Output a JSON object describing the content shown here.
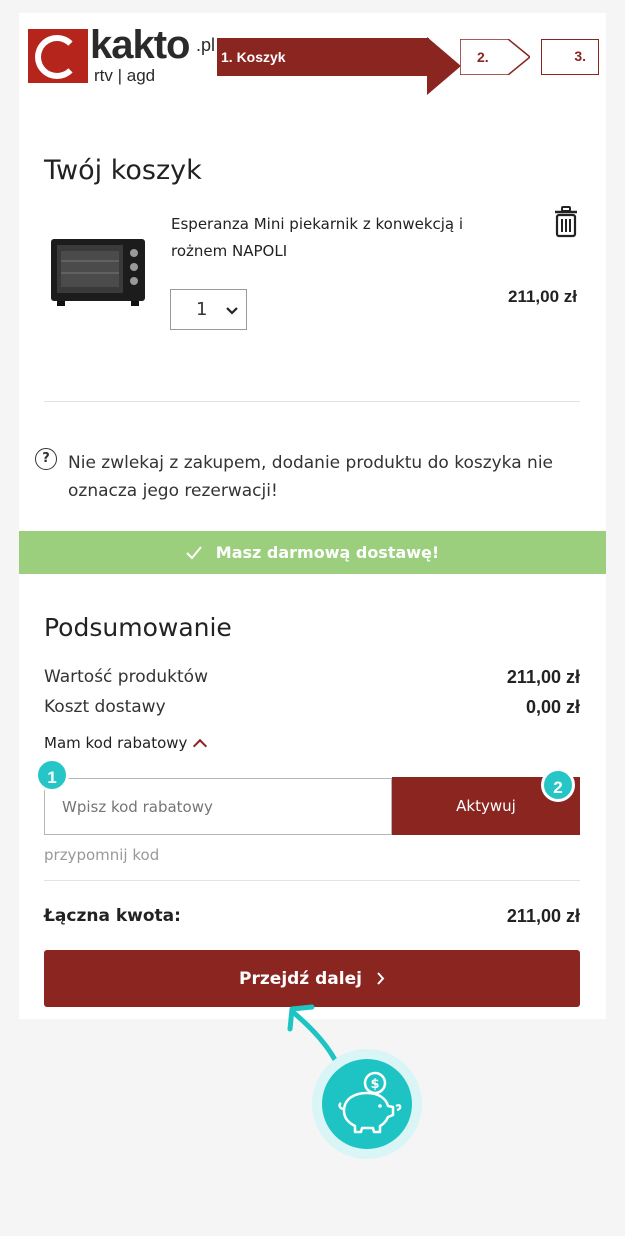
{
  "header": {
    "logo_text": "kakto",
    "logo_tld": ".pl",
    "logo_sub": "rtv | agd",
    "steps": [
      "1. Koszyk",
      "2.",
      "3."
    ],
    "active_step": 1,
    "brand_color": "#8b2520"
  },
  "cart": {
    "title": "Twój koszyk",
    "items": [
      {
        "name": "Esperanza Mini piekarnik z konwekcją i rożnem NAPOLI",
        "quantity": "1",
        "price": "211,00 zł",
        "icon": "trash-icon"
      }
    ],
    "note": "Nie zwlekaj z zakupem, dodanie produktu do koszyka nie oznacza jego rezerwacji!"
  },
  "free_delivery": {
    "text": "Masz darmową dostawę!",
    "color": "#9bcf7d"
  },
  "summary": {
    "title": "Podsumowanie",
    "products_label": "Wartość produktów",
    "products_value": "211,00 zł",
    "shipping_label": "Koszt dostawy",
    "shipping_value": "0,00 zł",
    "promo_toggle": "Mam kod rabatowy",
    "promo_placeholder": "Wpisz kod rabatowy",
    "promo_button": "Aktywuj",
    "promo_badge_1": "1",
    "promo_badge_2": "2",
    "reminder": "przypomnij kod",
    "total_label": "Łączna kwota:",
    "total_value": "211,00 zł",
    "cta": "Przejdź dalej"
  },
  "accent_color": "#1ec4c4"
}
